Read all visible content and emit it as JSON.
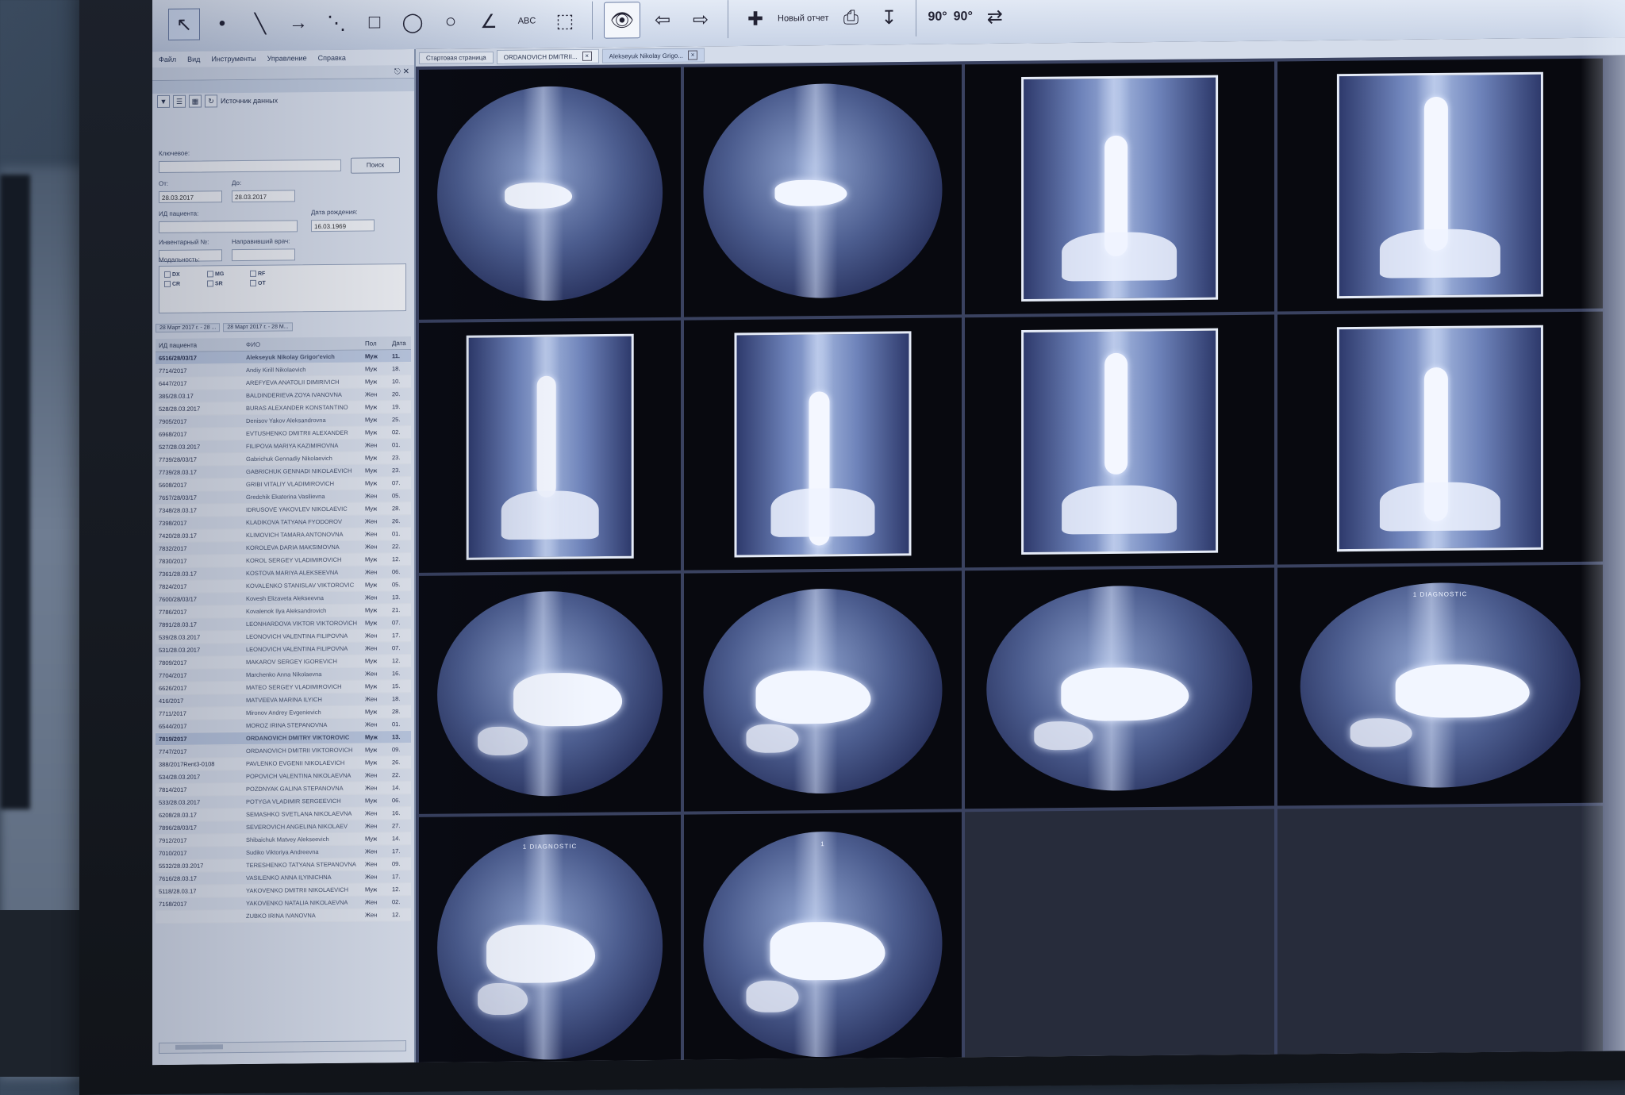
{
  "toolbar": {
    "new_report_label": "Новый отчет",
    "text_tool_label": "ABC",
    "rotate_left_label": "90°",
    "rotate_right_label": "90°"
  },
  "menu": [
    "Файл",
    "Вид",
    "Инструменты",
    "Управление",
    "Справка"
  ],
  "search_panel": {
    "source_label": "Источник данных",
    "keyword_label": "Ключевое:",
    "search_button": "Поиск",
    "from_label": "От:",
    "from_value": "28.03.2017",
    "to_label": "До:",
    "to_value": "28.03.2017",
    "patient_id_label": "ИД пациента:",
    "birthdate_label": "Дата рождения:",
    "birthdate_value": "16.03.1969",
    "accession_label": "Инвентарный №:",
    "referring_label": "Направивший врач:",
    "modality_label": "Модальность:",
    "modalities": [
      "DX",
      "CR",
      "MG",
      "SR",
      "RF",
      "OT"
    ]
  },
  "subtabs": [
    "28 Март 2017 г. - 28 ...",
    "28 Март 2017 г. - 28 М..."
  ],
  "table": {
    "columns": [
      "ИД пациента",
      "ФИО",
      "Пол",
      "Дата"
    ],
    "rows": [
      {
        "id": "6516/28/03/17",
        "name": "Alekseyuk Nikolay Grigor'evich",
        "sex": "Муж",
        "date": "11."
      },
      {
        "id": "7714/2017",
        "name": "Andiy Kirill Nikolaevich",
        "sex": "Муж",
        "date": "18."
      },
      {
        "id": "6447/2017",
        "name": "AREFYEVA ANATOLII DIMIRIVICH",
        "sex": "Муж",
        "date": "10."
      },
      {
        "id": "385/28.03.17",
        "name": "BALDINDERIEVA ZOYA IVANOVNA",
        "sex": "Жен",
        "date": "20."
      },
      {
        "id": "528/28.03.2017",
        "name": "BURAS ALEXANDER KONSTANTINO",
        "sex": "Муж",
        "date": "19."
      },
      {
        "id": "7905/2017",
        "name": "Denisov Yakov Aleksandrovna",
        "sex": "Муж",
        "date": "25."
      },
      {
        "id": "6968/2017",
        "name": "EVTUSHENKO DMITRII ALEXANDER",
        "sex": "Муж",
        "date": "02."
      },
      {
        "id": "527/28.03.2017",
        "name": "FILIPOVA MARIYA KAZIMIROVNA",
        "sex": "Жен",
        "date": "01."
      },
      {
        "id": "7739/28/03/17",
        "name": "Gabrichuk Gennadiy Nikolaevich",
        "sex": "Муж",
        "date": "23."
      },
      {
        "id": "7739/28.03.17",
        "name": "GABRICHUK GENNADI NIKOLAEVICH",
        "sex": "Муж",
        "date": "23."
      },
      {
        "id": "5608/2017",
        "name": "GRIBI VITALIY VLADIMIROVICH",
        "sex": "Муж",
        "date": "07."
      },
      {
        "id": "7657/28/03/17",
        "name": "Gredchik Ekaterina Vasilievna",
        "sex": "Жен",
        "date": "05."
      },
      {
        "id": "7348/28.03.17",
        "name": "IDRUSOVE YAKOVLEV NIKOLAEVIC",
        "sex": "Муж",
        "date": "28."
      },
      {
        "id": "7398/2017",
        "name": "KLADIKOVA TATYANA FYODOROV",
        "sex": "Жен",
        "date": "26."
      },
      {
        "id": "7420/28.03.17",
        "name": "KLIMOVICH TAMARA ANTONOVNA",
        "sex": "Жен",
        "date": "01."
      },
      {
        "id": "7832/2017",
        "name": "KOROLEVA DARIA MAKSIMOVNA",
        "sex": "Жен",
        "date": "22."
      },
      {
        "id": "7830/2017",
        "name": "KOROL SERGEY VLADIMIROVICH",
        "sex": "Муж",
        "date": "12."
      },
      {
        "id": "7361/28.03.17",
        "name": "KOSTOVA MARIYA ALEKSEEVNA",
        "sex": "Жен",
        "date": "06."
      },
      {
        "id": "7824/2017",
        "name": "KOVALENKO STANISLAV VIKTOROVIC",
        "sex": "Муж",
        "date": "05."
      },
      {
        "id": "7600/28/03/17",
        "name": "Kovesh Elizaveta Alekseevna",
        "sex": "Жен",
        "date": "13."
      },
      {
        "id": "7786/2017",
        "name": "Kovalenok Ilya Aleksandrovich",
        "sex": "Муж",
        "date": "21."
      },
      {
        "id": "7891/28.03.17",
        "name": "LEONHARDOVA VIKTOR VIKTOROVICH",
        "sex": "Муж",
        "date": "07."
      },
      {
        "id": "539/28.03.2017",
        "name": "LEONOVICH VALENTINA FILIPOVNA",
        "sex": "Жен",
        "date": "17."
      },
      {
        "id": "531/28.03.2017",
        "name": "LEONOVICH VALENTINA FILIPOVNA",
        "sex": "Жен",
        "date": "07."
      },
      {
        "id": "7809/2017",
        "name": "MAKAROV SERGEY IGOREVICH",
        "sex": "Муж",
        "date": "12."
      },
      {
        "id": "7704/2017",
        "name": "Marchenko Anna Nikolaevna",
        "sex": "Жен",
        "date": "16."
      },
      {
        "id": "6626/2017",
        "name": "MATEO SERGEY VLADIMIROVICH",
        "sex": "Муж",
        "date": "15."
      },
      {
        "id": "416/2017",
        "name": "MATVEEVA MARINA ILYICH",
        "sex": "Жен",
        "date": "18."
      },
      {
        "id": "7711/2017",
        "name": "Mironov Andrey Evgenievich",
        "sex": "Муж",
        "date": "28."
      },
      {
        "id": "6544/2017",
        "name": "MOROZ IRINA STEPANOVNA",
        "sex": "Жен",
        "date": "01."
      },
      {
        "id": "7819/2017",
        "name": "ORDANOVICH DMITRY VIKTOROVIC",
        "sex": "Муж",
        "date": "13."
      },
      {
        "id": "7747/2017",
        "name": "ORDANOVICH DMITRII VIKTOROVICH",
        "sex": "Муж",
        "date": "09."
      },
      {
        "id": "388/2017Rent3-0108",
        "name": "PAVLENKO EVGENII NIKOLAEVICH",
        "sex": "Муж",
        "date": "26."
      },
      {
        "id": "534/28.03.2017",
        "name": "POPOVICH VALENTINA NIKOLAEVNA",
        "sex": "Жен",
        "date": "22."
      },
      {
        "id": "7814/2017",
        "name": "POZDNYAK GALINA STEPANOVNA",
        "sex": "Жен",
        "date": "14."
      },
      {
        "id": "533/28.03.2017",
        "name": "POTYGA VLADIMIR SERGEEVICH",
        "sex": "Муж",
        "date": "06."
      },
      {
        "id": "6208/28.03.17",
        "name": "SEMASHKO SVETLANA NIKOLAEVNA",
        "sex": "Жен",
        "date": "16."
      },
      {
        "id": "7896/28/03/17",
        "name": "SEVEROVICH ANGELINA NIKOLAEV",
        "sex": "Жен",
        "date": "27."
      },
      {
        "id": "7912/2017",
        "name": "Shibaichuk Matvey Alekseevich",
        "sex": "Муж",
        "date": "14."
      },
      {
        "id": "7010/2017",
        "name": "Sudiko Viktoriya Andreevna",
        "sex": "Жен",
        "date": "17."
      },
      {
        "id": "5532/28.03.2017",
        "name": "TERESHENKO TATYANA STEPANOVNA",
        "sex": "Жен",
        "date": "09."
      },
      {
        "id": "7616/28.03.17",
        "name": "VASILENKO ANNA ILYINICHNA",
        "sex": "Жен",
        "date": "17."
      },
      {
        "id": "5118/28.03.17",
        "name": "YAKOVENKO DMITRII NIKOLAEVICH",
        "sex": "Муж",
        "date": "12."
      },
      {
        "id": "7158/2017",
        "name": "YAKOVENKO NATALIA NIKOLAEVNA",
        "sex": "Жен",
        "date": "02."
      },
      {
        "id": "",
        "name": "ZUBKO IRINA IVANOVNA",
        "sex": "Жен",
        "date": "12."
      }
    ]
  },
  "viewer": {
    "tabs": [
      "Стартовая страница",
      "ORDANOVICH DMITRII...",
      "Alekseyuk Nikolay Grigo..."
    ]
  },
  "thumbnails": [
    {
      "kind": "circle",
      "label": ""
    },
    {
      "kind": "circle",
      "label": ""
    },
    {
      "kind": "rect",
      "label": ""
    },
    {
      "kind": "rect",
      "label": ""
    },
    {
      "kind": "rect",
      "label": ""
    },
    {
      "kind": "rect",
      "label": ""
    },
    {
      "kind": "rect",
      "label": ""
    },
    {
      "kind": "rect",
      "label": ""
    },
    {
      "kind": "circle",
      "label": ""
    },
    {
      "kind": "circle",
      "label": ""
    },
    {
      "kind": "circle",
      "label": ""
    },
    {
      "kind": "circle",
      "label": "1 DIAGNOSTIC"
    },
    {
      "kind": "circle",
      "label": "1 DIAGNOSTIC"
    },
    {
      "kind": "circle",
      "label": "1"
    },
    {
      "kind": "empty",
      "label": ""
    },
    {
      "kind": "empty",
      "label": ""
    }
  ]
}
